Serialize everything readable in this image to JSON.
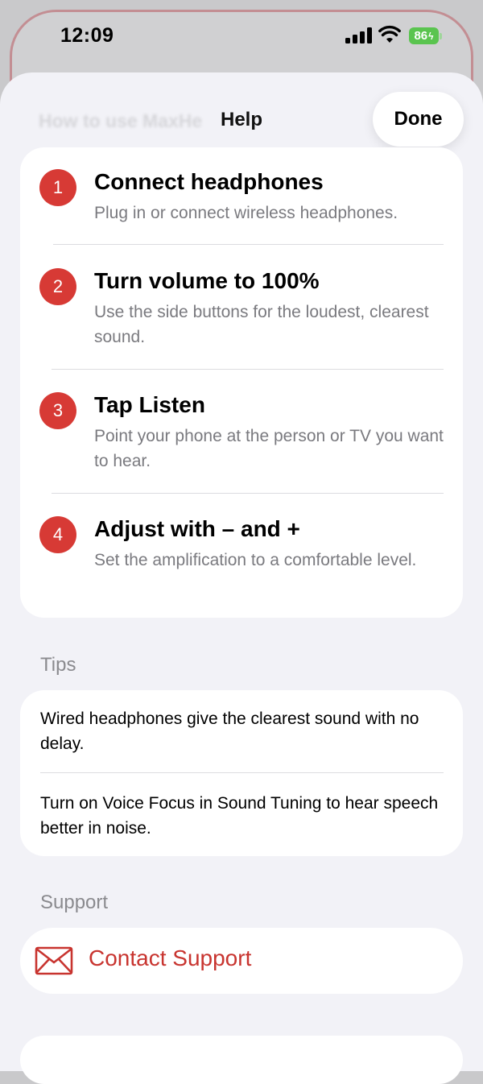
{
  "status_bar": {
    "time": "12:09",
    "battery": "86"
  },
  "sheet": {
    "background_title": "How to use MaxHe",
    "title": "Help",
    "done_label": "Done"
  },
  "steps": [
    {
      "number": "1",
      "title": "Connect headphones",
      "description": "Plug in or connect wireless headphones."
    },
    {
      "number": "2",
      "title": "Turn volume to 100%",
      "description": "Use the side buttons for the loudest, clearest sound."
    },
    {
      "number": "3",
      "title": "Tap Listen",
      "description": "Point your phone at the person or TV you want to hear."
    },
    {
      "number": "4",
      "title": "Adjust with – and +",
      "description": "Set the amplification to a comfortable level."
    }
  ],
  "tips": {
    "header": "Tips",
    "items": [
      "Wired headphones give the clearest sound with no delay.",
      "Turn on Voice Focus in Sound Tuning to hear speech better in noise."
    ]
  },
  "support": {
    "header": "Support",
    "contact_label": "Contact Support",
    "icon": "mail-icon"
  },
  "colors": {
    "accent": "#d73a35",
    "support_text": "#c8342f",
    "secondary_text": "#7a7a7f",
    "sheet_bg": "#f2f2f7",
    "battery": "#5ac44f"
  }
}
